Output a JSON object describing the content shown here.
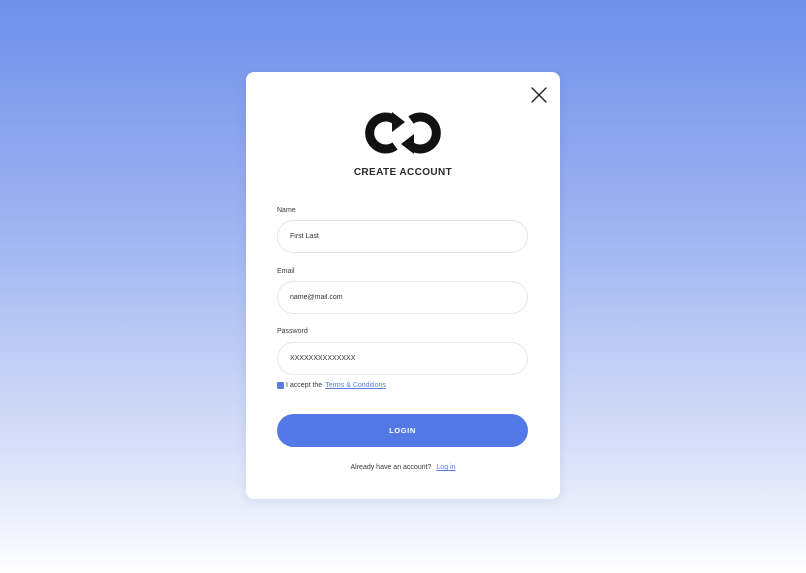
{
  "modal": {
    "title": "CREATE ACCOUNT",
    "close_icon": "close-icon",
    "logo_icon": "infinity-logo"
  },
  "form": {
    "name_label": "Name",
    "name_value": "First Last",
    "email_label": "Email",
    "email_value": "name@mail.com",
    "password_label": "Password",
    "password_value": "XXXXXXXXXXXXXX",
    "terms_prefix": "I accept the",
    "terms_link": "Terms & Conditions",
    "terms_checked": true
  },
  "actions": {
    "login_label": "LOGIN",
    "footer_prefix": "Already have an account?",
    "footer_link": "Log in"
  },
  "colors": {
    "accent": "#5479e6",
    "link": "#5b7be4",
    "background_top": "#6f8fea",
    "background_bottom": "#ffffff"
  }
}
